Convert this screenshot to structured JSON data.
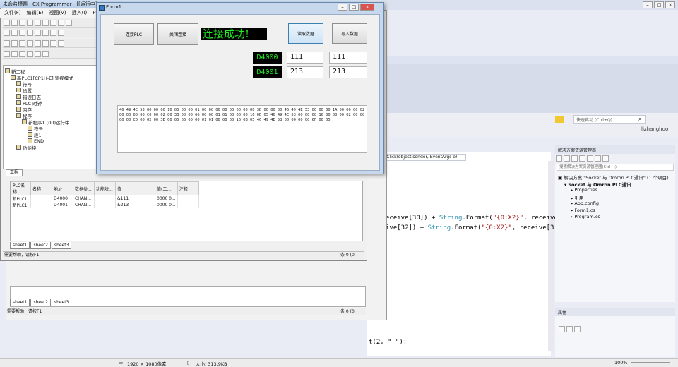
{
  "cx_window": {
    "title": "未命名標題 - CX-Programmer - [[运行中]",
    "menu": [
      "文件(F)",
      "编辑(E)",
      "视图(V)",
      "插入(I)",
      "PLC"
    ],
    "tree": [
      {
        "label": "新工程",
        "indent": 0
      },
      {
        "label": "新PLC1[CP1H-E] 监视模式",
        "indent": 1
      },
      {
        "label": "符号",
        "indent": 2
      },
      {
        "label": "设置",
        "indent": 2
      },
      {
        "label": "错误日志",
        "indent": 2
      },
      {
        "label": "PLC 时钟",
        "indent": 2
      },
      {
        "label": "内存",
        "indent": 2
      },
      {
        "label": "程序",
        "indent": 2
      },
      {
        "label": "新程序1 (00)运行中",
        "indent": 3
      },
      {
        "label": "符号",
        "indent": 4
      },
      {
        "label": "段1",
        "indent": 4
      },
      {
        "label": "END",
        "indent": 4
      },
      {
        "label": "功能块",
        "indent": 2
      }
    ],
    "tree_tab": "工程",
    "watch_headers": [
      "PLC名称",
      "名称",
      "地址",
      "数据类...",
      "功能块...",
      "值",
      "值(二...",
      "注释"
    ],
    "watch_rows": [
      [
        "新PLC1",
        "",
        "D4000",
        "CHAN...",
        "",
        "&111",
        "0000 0...",
        ""
      ],
      [
        "新PLC1",
        "",
        "D4001",
        "CHAN...",
        "",
        "&213",
        "0000 0...",
        ""
      ]
    ],
    "sheets": [
      "sheet1",
      "sheet2",
      "sheet3"
    ],
    "status_help": "需要帮助，请按F1",
    "status_right": "条 0 (0,",
    "status_right2": "条 0 (0,"
  },
  "form": {
    "title": "Form1",
    "btn_connect": "连接PLC",
    "btn_close": "关闭连接",
    "status_text": "连接成功!",
    "btn_read": "读取数据",
    "btn_write": "写入数据",
    "rows": [
      {
        "label": "D4000",
        "read": "111",
        "write": "111"
      },
      {
        "label": "D4001",
        "read": "213",
        "write": "213"
      }
    ],
    "hex": "46 49 4E 53 00 00 00 10 00 00 00 01 00 00 00 00 00 00 00 00 3B 00 00 00 46 49 4E 53 00 00 00 1A 00 00 00 02 00 00 00 00 C0 00 02 00 3B 00 00 66 00 00 01 01 00 00 00 16 0B 05 46 49 4E 53 00 00 00 16 00 00 00 02 00 00 00 00 C0 00 02 00 3B 00 00 66 00 00 01 01 00 00 00 16 0B 05 46 49 4E 53 00 00 00 00 6F 00 D5"
  },
  "vs": {
    "search_placeholder": "快速启动 (Ctrl+Q)",
    "user": "lizhanghuo",
    "method": "on4_Click(object sender, EventArgs e)",
    "code_lines": [
      {
        "pre": "eceive[30]) + ",
        "type": "String",
        "mid": ".Format(",
        "str": "\"{0:X2}\"",
        "post": ", receive"
      },
      {
        "pre": "ive[32]) + ",
        "type": "String",
        "mid": ".Format(",
        "str": "\"{0:X2}\"",
        "post": ", receive[3"
      }
    ],
    "code_tail": "t(2, \" \");",
    "se_title": "解决方案资源管理器",
    "se_search": "搜索解决方案资源管理器(Ctrl+;)",
    "se_items": [
      {
        "label": "解决方案 \"Socket 与 Omron PLC通讯\" (1 个项目)",
        "indent": 0
      },
      {
        "label": "Socket 与 Omron PLC通讯",
        "indent": 1
      },
      {
        "label": "Properties",
        "indent": 2
      },
      {
        "label": "引用",
        "indent": 2
      },
      {
        "label": "App.config",
        "indent": 2
      },
      {
        "label": "Form1.cs",
        "indent": 2
      },
      {
        "label": "Program.cs",
        "indent": 2
      }
    ],
    "props_title": "属性"
  },
  "taskbar": {
    "resolution": "1920 × 1080像素",
    "size": "大小: 313.9KB",
    "zoom": "100%"
  }
}
